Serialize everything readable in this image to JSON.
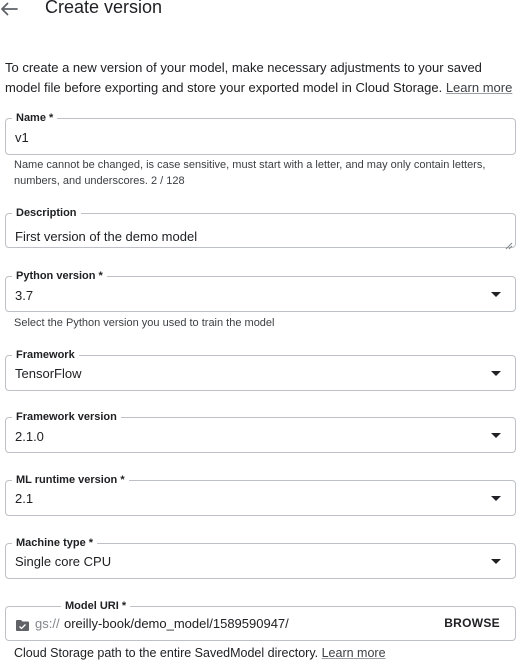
{
  "header": {
    "title": "Create version"
  },
  "intro": {
    "text": "To create a new version of your model, make necessary adjustments to your saved model file before exporting and store your exported model in Cloud Storage.",
    "link": "Learn more"
  },
  "fields": {
    "name": {
      "label": "Name *",
      "value": "v1",
      "hint": "Name cannot be changed, is case sensitive, must start with a letter, and may only contain letters, numbers, and underscores. 2 / 128"
    },
    "description": {
      "label": "Description",
      "value": "First version of the demo model"
    },
    "python_version": {
      "label": "Python version *",
      "value": "3.7",
      "hint": "Select the Python version you used to train the model"
    },
    "framework": {
      "label": "Framework",
      "value": "TensorFlow"
    },
    "framework_version": {
      "label": "Framework version",
      "value": "2.1.0"
    },
    "ml_runtime_version": {
      "label": "ML runtime version *",
      "value": "2.1"
    },
    "machine_type": {
      "label": "Machine type *",
      "value": "Single core CPU"
    },
    "model_uri": {
      "label": "Model URI *",
      "prefix": "gs://",
      "value": "oreilly-book/demo_model/1589590947/",
      "browse_label": "BROWSE",
      "hint": "Cloud Storage path to the entire SavedModel directory.",
      "hint_link": "Learn more"
    }
  },
  "icons": {
    "back": "arrow-back-icon",
    "dropdown": "arrow-drop-down-icon",
    "folder": "folder-check-icon"
  }
}
